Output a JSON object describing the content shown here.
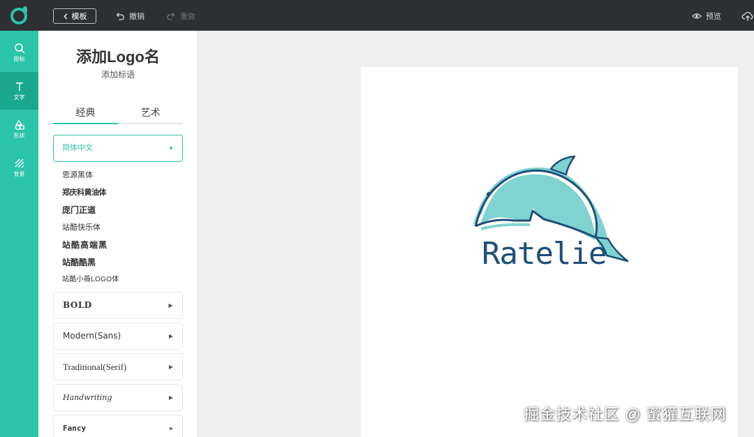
{
  "colors": {
    "accent": "#2cc4a8",
    "toolbar": "#2d2f33",
    "canvas_bg": "#efefef",
    "logo_blue": "#1f4f7a",
    "logo_teal": "#7fd3d0"
  },
  "toolbar": {
    "back_label": "模板",
    "undo_label": "撤销",
    "redo_label": "重做",
    "preview_label": "预览",
    "icons": [
      "app-logo-icon",
      "chevron-left-icon",
      "undo-icon",
      "redo-icon",
      "eye-icon",
      "cloud-upload-icon"
    ]
  },
  "sidebar": {
    "items": [
      {
        "label": "图标",
        "icon": "search-icon"
      },
      {
        "label": "文字",
        "icon": "text-icon",
        "active": true
      },
      {
        "label": "形状",
        "icon": "shapes-icon"
      },
      {
        "label": "背景",
        "icon": "hatch-icon"
      }
    ]
  },
  "panel": {
    "brand_title": "添加Logo名",
    "brand_slogan": "添加标语",
    "tabs": [
      "经典",
      "艺术"
    ],
    "active_tab": "经典",
    "select_value": "简体中文",
    "fonts": [
      "思源黑体",
      "郑庆科黄油体",
      "庞门正道",
      "站酷快乐体",
      "站酷高端黑",
      "站酷酷黑",
      "站酷小薇LOGO体"
    ],
    "categories": [
      "BOLD",
      "Modern(Sans)",
      "Traditional(Serif)",
      "Handwriting",
      "Fancy"
    ]
  },
  "canvas": {
    "logo_text": "Ratelie"
  },
  "watermark": "掘金技术社区 @ 蜜獾互联网"
}
